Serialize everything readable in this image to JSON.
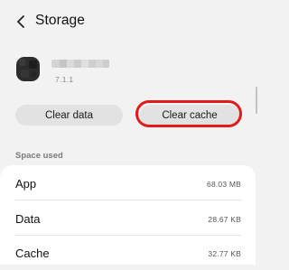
{
  "header": {
    "title": "Storage",
    "back_icon": "chevron-left-icon"
  },
  "app_info": {
    "icon": "app-icon",
    "version": "7.1.1"
  },
  "actions": {
    "clear_data_label": "Clear data",
    "clear_cache_label": "Clear cache",
    "highlight_color": "#e21a1a"
  },
  "space_used": {
    "section_label": "Space used",
    "rows": [
      {
        "label": "App",
        "value": "68.03 MB"
      },
      {
        "label": "Data",
        "value": "28.67 KB"
      },
      {
        "label": "Cache",
        "value": "32.77 KB"
      }
    ]
  },
  "colors": {
    "background": "#f2f2f2",
    "card": "#ffffff",
    "button": "#e2e2e2",
    "highlight": "#e21a1a"
  }
}
